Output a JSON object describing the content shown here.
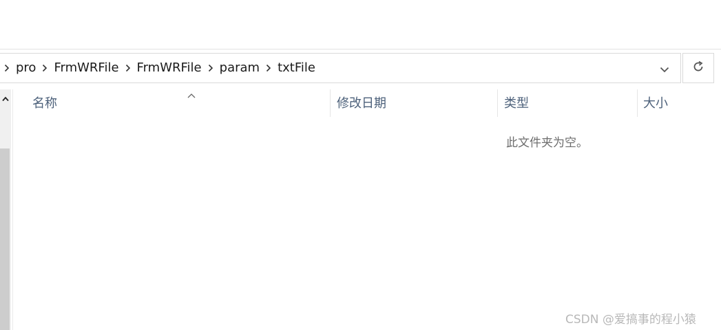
{
  "breadcrumb": {
    "items": [
      {
        "label": "pro"
      },
      {
        "label": "FrmWRFile"
      },
      {
        "label": "FrmWRFile"
      },
      {
        "label": "param"
      },
      {
        "label": "txtFile"
      }
    ]
  },
  "icons": {
    "separator": "chevron-right-icon",
    "dropdown": "chevron-down-icon",
    "refresh": "refresh-icon",
    "sort": "sort-ascending-icon",
    "scroll_up": "scroll-up-icon"
  },
  "columns": {
    "name": "名称",
    "modified": "修改日期",
    "type": "类型",
    "size": "大小"
  },
  "file_list": {
    "empty_message": "此文件夹为空。"
  },
  "watermark": {
    "text": "CSDN @爱搞事的程小猿"
  },
  "colors": {
    "header_text": "#4c607a",
    "border": "#d9d9d9",
    "scrollbar_thumb": "#cdcdcd"
  }
}
